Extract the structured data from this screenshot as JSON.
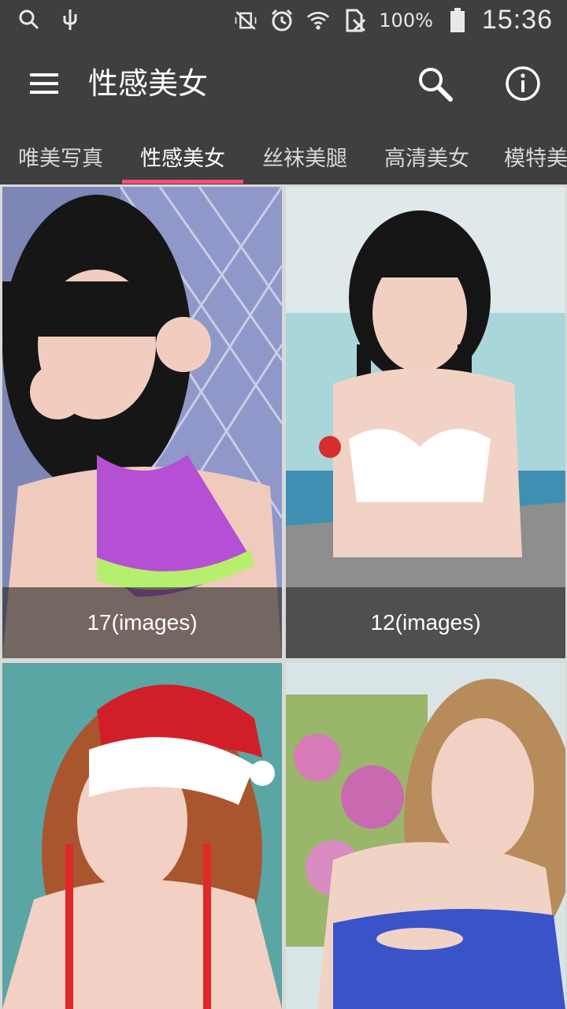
{
  "statusbar": {
    "battery": "100%",
    "time": "15:36"
  },
  "toolbar": {
    "title": "性感美女"
  },
  "tabs": [
    {
      "label": "唯美写真"
    },
    {
      "label": "性感美女"
    },
    {
      "label": "丝袜美腿"
    },
    {
      "label": "高清美女"
    },
    {
      "label": "模特美"
    }
  ],
  "cards": [
    {
      "caption": "17(images)"
    },
    {
      "caption": "12(images)"
    },
    {
      "caption": ""
    },
    {
      "caption": ""
    }
  ],
  "colors": {
    "appbar": "#3f3f3f",
    "tab_indicator": "#ff4f7a"
  }
}
